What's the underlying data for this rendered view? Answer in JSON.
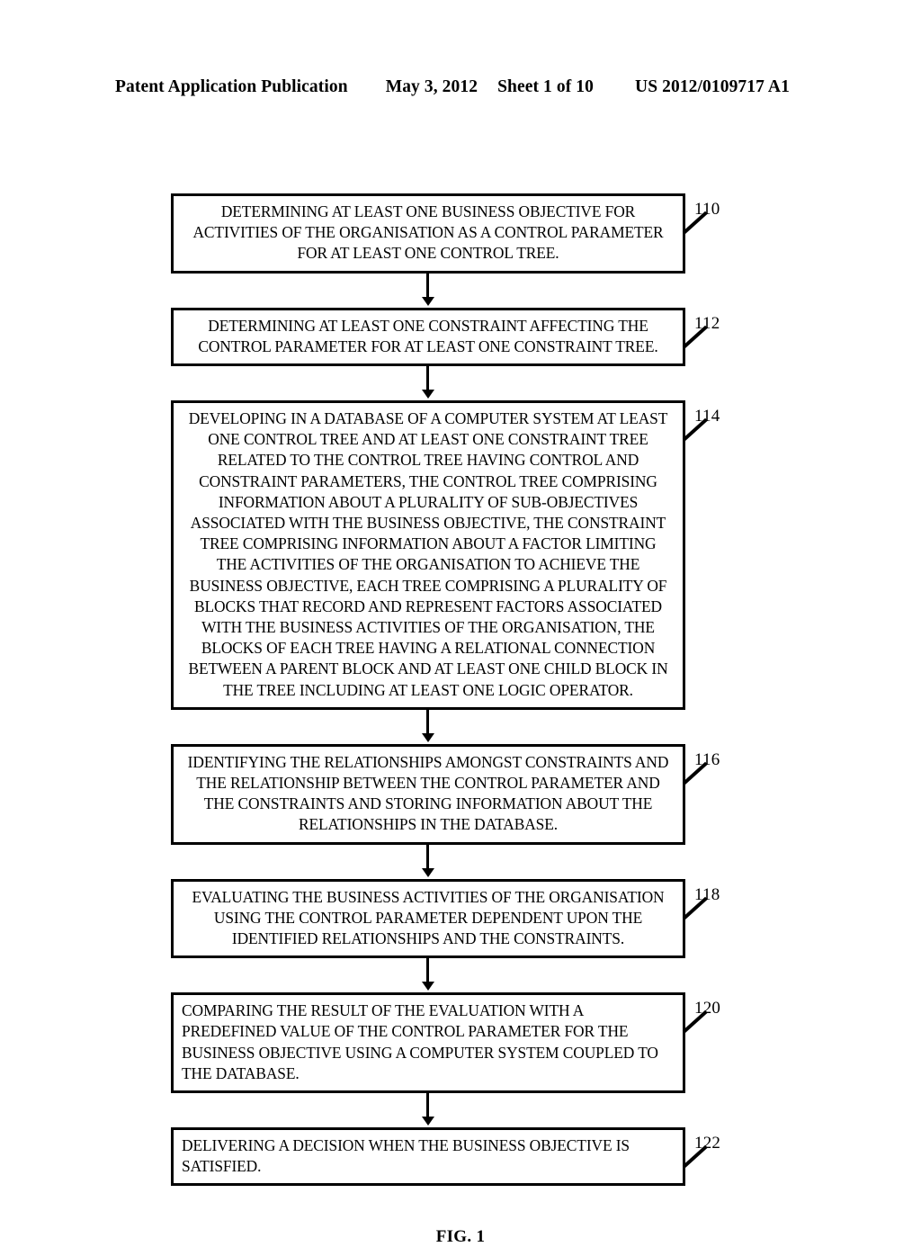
{
  "header": {
    "publication": "Patent Application Publication",
    "date": "May 3, 2012",
    "sheet": "Sheet 1 of 10",
    "document_number": "US 2012/0109717 A1"
  },
  "figure": {
    "caption": "FIG. 1",
    "type": "flowchart",
    "steps": [
      {
        "ref": "110",
        "align": "center",
        "lines": [
          "DETERMINING AT LEAST ONE BUSINESS OBJECTIVE FOR",
          "ACTIVITIES OF THE ORGANISATION AS A CONTROL PARAMETER",
          "FOR AT LEAST ONE CONTROL TREE."
        ]
      },
      {
        "ref": "112",
        "align": "center",
        "lines": [
          "DETERMINING AT LEAST ONE CONSTRAINT AFFECTING THE",
          "CONTROL PARAMETER FOR AT LEAST ONE CONSTRAINT TREE."
        ]
      },
      {
        "ref": "114",
        "align": "center",
        "lines": [
          "DEVELOPING IN A DATABASE OF A COMPUTER SYSTEM AT LEAST",
          "ONE CONTROL TREE AND AT LEAST ONE CONSTRAINT TREE",
          "RELATED TO THE CONTROL TREE HAVING CONTROL AND",
          "CONSTRAINT PARAMETERS, THE CONTROL TREE COMPRISING",
          "INFORMATION ABOUT A PLURALITY OF SUB-OBJECTIVES",
          "ASSOCIATED WITH THE BUSINESS OBJECTIVE, THE CONSTRAINT",
          "TREE COMPRISING INFORMATION ABOUT A FACTOR LIMITING",
          "THE ACTIVITIES OF THE ORGANISATION TO ACHIEVE THE",
          "BUSINESS OBJECTIVE, EACH TREE COMPRISING A PLURALITY OF",
          "BLOCKS THAT RECORD AND REPRESENT FACTORS ASSOCIATED",
          "WITH THE BUSINESS ACTIVITIES OF THE ORGANISATION, THE",
          "BLOCKS OF EACH TREE HAVING A RELATIONAL CONNECTION",
          "BETWEEN A PARENT BLOCK AND AT LEAST ONE CHILD BLOCK IN",
          "THE TREE INCLUDING AT LEAST ONE LOGIC OPERATOR."
        ]
      },
      {
        "ref": "116",
        "align": "center",
        "lines": [
          "IDENTIFYING THE RELATIONSHIPS AMONGST CONSTRAINTS AND",
          "THE RELATIONSHIP BETWEEN THE CONTROL PARAMETER AND",
          "THE CONSTRAINTS AND STORING INFORMATION ABOUT THE",
          "RELATIONSHIPS IN THE DATABASE."
        ]
      },
      {
        "ref": "118",
        "align": "center",
        "lines": [
          "EVALUATING THE BUSINESS ACTIVITIES OF THE ORGANISATION",
          "USING THE CONTROL PARAMETER DEPENDENT UPON THE",
          "IDENTIFIED RELATIONSHIPS AND THE CONSTRAINTS."
        ]
      },
      {
        "ref": "120",
        "align": "left",
        "lines": [
          "COMPARING THE RESULT OF THE EVALUATION WITH A",
          "PREDEFINED VALUE OF THE CONTROL PARAMETER FOR THE",
          "BUSINESS OBJECTIVE USING A COMPUTER SYSTEM COUPLED TO",
          "THE DATABASE."
        ]
      },
      {
        "ref": "122",
        "align": "left",
        "lines": [
          "DELIVERING A DECISION WHEN THE BUSINESS OBJECTIVE IS",
          "SATISFIED."
        ]
      }
    ]
  }
}
